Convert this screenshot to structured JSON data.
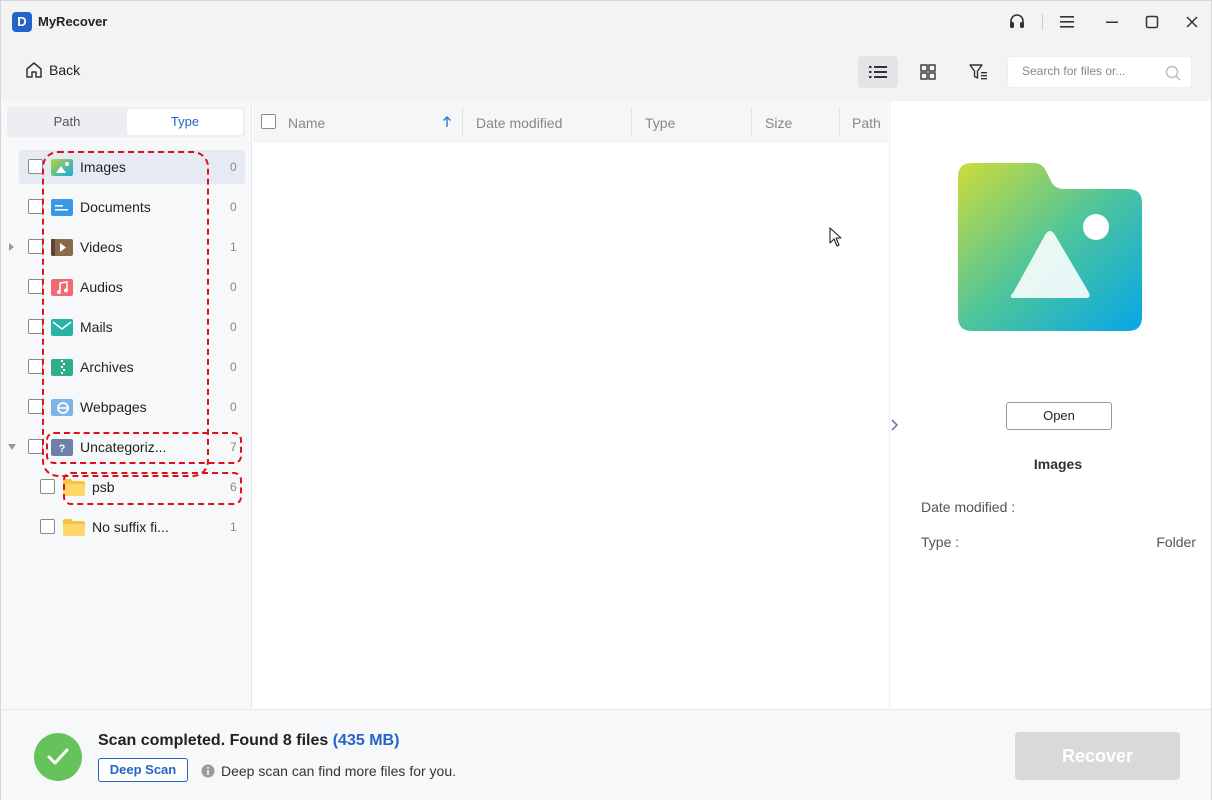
{
  "app": {
    "title": "MyRecover",
    "logo_letter": "D"
  },
  "toolbar": {
    "back_label": "Back",
    "search_placeholder": "Search for files or..."
  },
  "left_panel": {
    "tabs": [
      {
        "label": "Path",
        "active": false
      },
      {
        "label": "Type",
        "active": true
      }
    ],
    "items": [
      {
        "label": "Images",
        "count": "0",
        "icon": "images-icon",
        "selected": true
      },
      {
        "label": "Documents",
        "count": "0",
        "icon": "documents-icon"
      },
      {
        "label": "Videos",
        "count": "1",
        "icon": "videos-icon",
        "expandable": true
      },
      {
        "label": "Audios",
        "count": "0",
        "icon": "audios-icon"
      },
      {
        "label": "Mails",
        "count": "0",
        "icon": "mails-icon"
      },
      {
        "label": "Archives",
        "count": "0",
        "icon": "archives-icon"
      },
      {
        "label": "Webpages",
        "count": "0",
        "icon": "webpages-icon"
      },
      {
        "label": "Uncategoriz...",
        "count": "7",
        "icon": "uncategorized-icon",
        "expanded": true
      },
      {
        "label": "psb",
        "count": "6",
        "icon": "folder-icon",
        "child": true
      },
      {
        "label": "No suffix fi...",
        "count": "1",
        "icon": "folder-icon",
        "child": true
      }
    ]
  },
  "list": {
    "columns": [
      "Name",
      "Date modified",
      "Type",
      "Size",
      "Path"
    ]
  },
  "preview": {
    "open_label": "Open",
    "title": "Images",
    "date_label": "Date modified :",
    "date_value": "",
    "type_label": "Type :",
    "type_value": "Folder"
  },
  "footer": {
    "status_prefix": "Scan completed. Found 8 files",
    "status_size": "(435 MB)",
    "deep_scan_label": "Deep Scan",
    "info_text": "Deep scan can find more files for you.",
    "recover_label": "Recover"
  },
  "colors": {
    "accent": "#2563c9",
    "success": "#66c25a",
    "annotation": "#e0101a",
    "disabled": "#d9d9d9"
  }
}
